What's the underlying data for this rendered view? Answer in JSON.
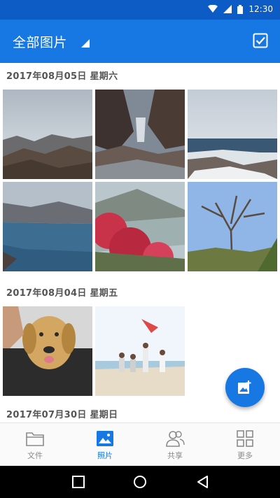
{
  "status_bar": {
    "time": "12:30",
    "icons": [
      "wifi-icon",
      "signal-icon",
      "battery-icon"
    ]
  },
  "app_bar": {
    "title": "全部图片",
    "background": "#1777e3",
    "actions": [
      "dropdown-icon",
      "select-checkbox-icon"
    ]
  },
  "sections": [
    {
      "date": "2017年08月05日 星期六",
      "photos": [
        "mountain-valley",
        "waterfall-canyon",
        "snowy-coast",
        "crater-lake",
        "red-flowers",
        "bare-tree"
      ]
    },
    {
      "date": "2017年08月04日 星期五",
      "photos": [
        "puppy-in-bag",
        "family-at-beach"
      ]
    },
    {
      "date": "2017年07月30日 星期日",
      "photos": []
    }
  ],
  "fab": {
    "icon": "add-photo-icon"
  },
  "bottom_nav": {
    "items": [
      {
        "label": "文件",
        "icon": "folder-icon",
        "active": false
      },
      {
        "label": "照片",
        "icon": "photo-icon",
        "active": true
      },
      {
        "label": "共享",
        "icon": "people-icon",
        "active": false
      },
      {
        "label": "更多",
        "icon": "grid-icon",
        "active": false
      }
    ]
  },
  "colors": {
    "accent": "#1777e3",
    "status_bar": "#0d5cc6",
    "header_text": "#555555",
    "nav_inactive": "#8a8a8a"
  }
}
